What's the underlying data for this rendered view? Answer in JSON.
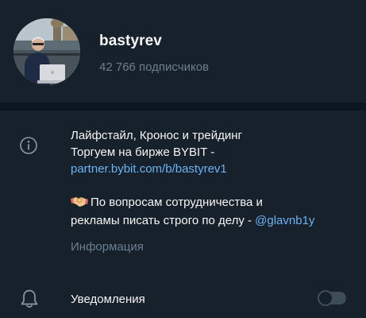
{
  "channel": {
    "name": "bastyrev",
    "subscribers": "42 766 подписчиков"
  },
  "about": {
    "line1": "Лайфстайл, Кронос и трейдинг",
    "line2": "Торгуем на бирже BYBIT -",
    "link": "partner.bybit.com/b/bastyrev1",
    "line4": "По вопросам сотрудничества и",
    "line5_text": "рекламы писать строго по делу - ",
    "line5_mention": "@glavnb1y",
    "label": "Информация"
  },
  "notifications": {
    "label": "Уведомления",
    "enabled": false
  },
  "icons": {
    "info": "info-circle-icon",
    "bell": "bell-icon",
    "handshake": "handshake-emoji"
  },
  "colors": {
    "background": "#17212b",
    "divider": "#0e1621",
    "text": "#f5f5f5",
    "secondary_text": "#6d7f8f",
    "link": "#6ab3f3"
  }
}
